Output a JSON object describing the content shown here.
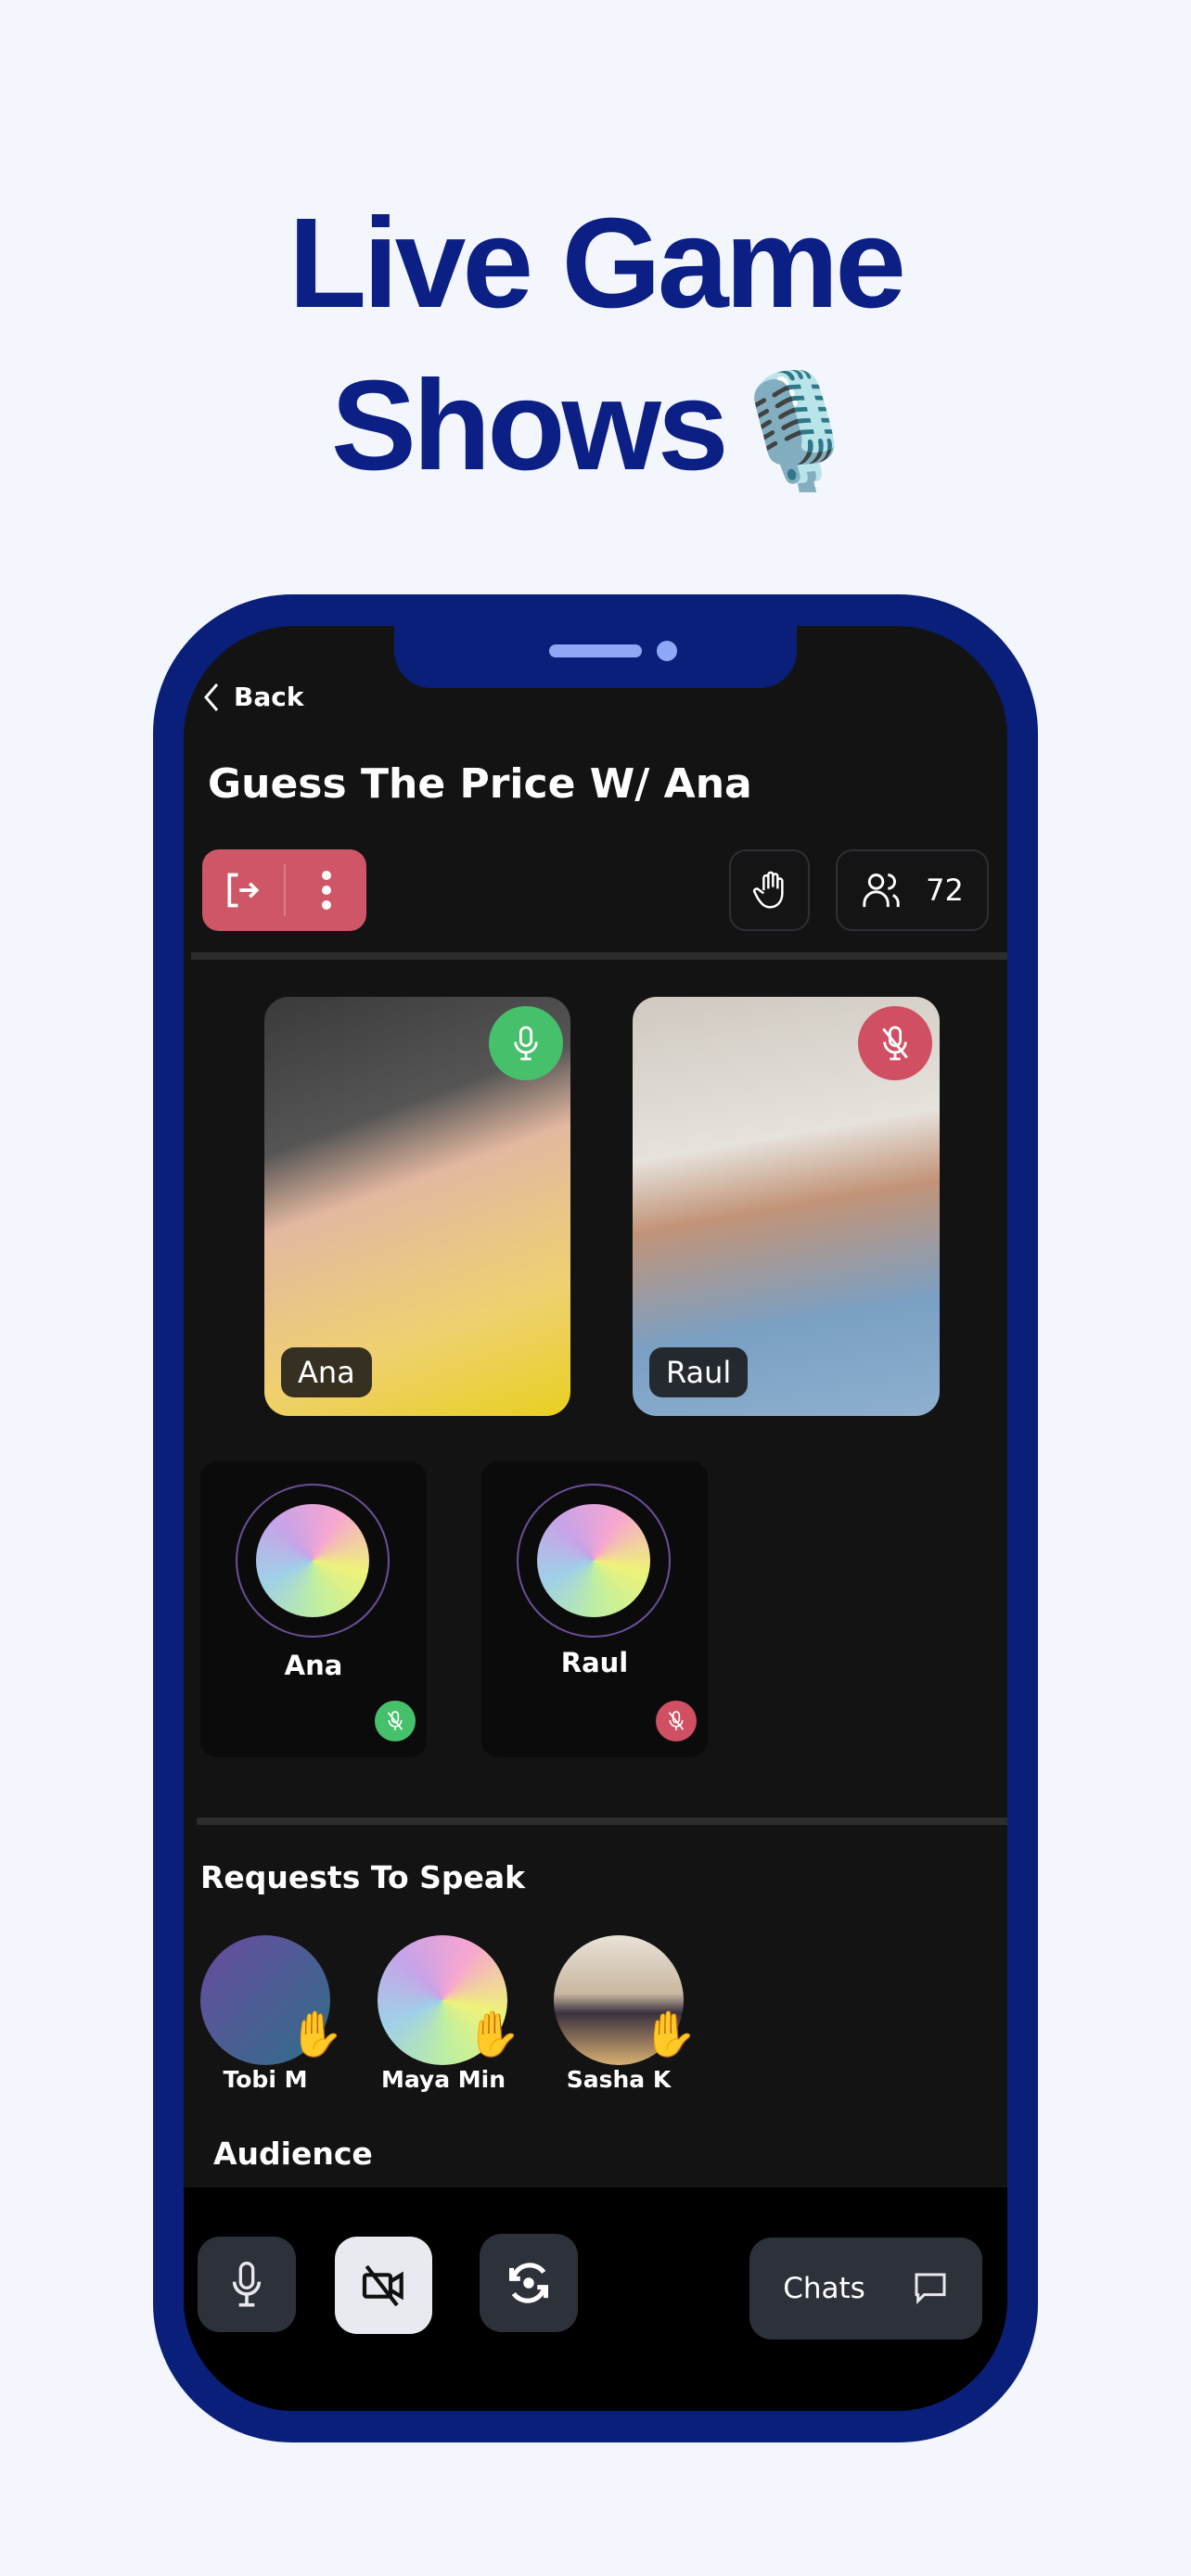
{
  "headline": {
    "line1": "Live Game",
    "line2": "Shows",
    "emoji": "🎙️"
  },
  "nav": {
    "back_label": "Back"
  },
  "room": {
    "title": "Guess The Price W/ Ana",
    "participant_count": "72"
  },
  "colors": {
    "brand": "#0b1f85",
    "leave": "#cf5666",
    "unmuted": "#46c06a",
    "muted": "#d04f62"
  },
  "video_tiles": [
    {
      "name": "Ana",
      "mic": "on"
    },
    {
      "name": "Raul",
      "mic": "off"
    }
  ],
  "audio_cards": [
    {
      "name": "Ana",
      "status": "green"
    },
    {
      "name": "Raul",
      "status": "red"
    }
  ],
  "requests": {
    "title": "Requests To Speak",
    "people": [
      {
        "name": "Tobi M",
        "emoji": "✋"
      },
      {
        "name": "Maya Min",
        "emoji": "✋"
      },
      {
        "name": "Sasha K",
        "emoji": "✋"
      }
    ]
  },
  "audience": {
    "title": "Audience"
  },
  "toolbar": {
    "chats_label": "Chats"
  }
}
